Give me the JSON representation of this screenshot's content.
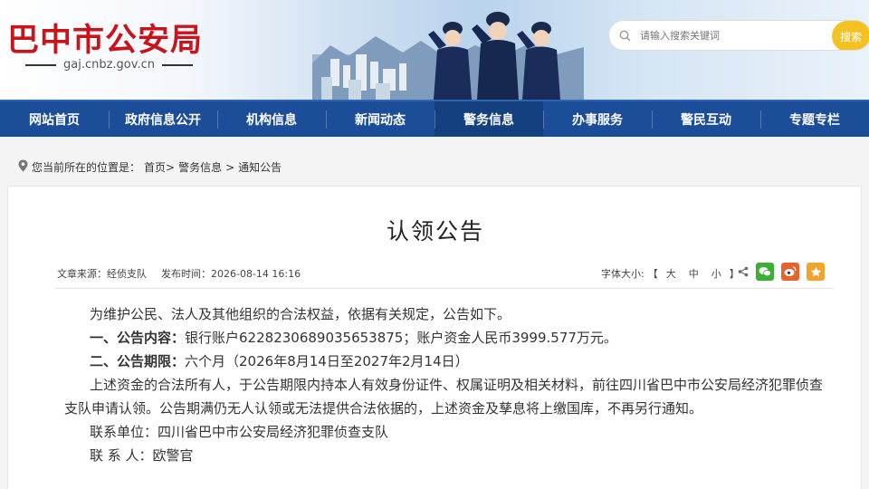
{
  "header": {
    "site_title": "巴中市公安局",
    "domain": "gaj.cnbz.gov.cn",
    "search_placeholder": "请输入搜索关键词",
    "search_button": "搜索"
  },
  "nav": {
    "items": [
      "网站首页",
      "政府信息公开",
      "机构信息",
      "新闻动态",
      "警务信息",
      "办事服务",
      "警民互动",
      "专题专栏"
    ],
    "active": "警务信息"
  },
  "breadcrumb": {
    "prefix": "您当前所在的位置是：",
    "home": "首页>",
    "section": "警务信息",
    "sep": ">",
    "current": "通知公告"
  },
  "article": {
    "title": "认领公告",
    "source_label": "文章来源：",
    "source": "经侦支队",
    "time_label": "发布时间：",
    "time": "2026-08-14 16:16",
    "fontsize_label": "字体大小:",
    "fontsize_open": "【",
    "fontsize_large": "大",
    "fontsize_medium": "中",
    "fontsize_small": "小",
    "fontsize_close": "】",
    "p1": "为维护公民、法人及其他组织的合法权益，依据有关规定，公告如下。",
    "p2_label": "一、公告内容：",
    "p2_text": "银行账户6228230689035653875；账户资金人民币3999.577万元。",
    "p3_label": "二、公告期限：",
    "p3_text": "六个月（2026年8月14日至2027年2月14日）",
    "p4_line1": "上述资金的合法所有人，于公告期限内持本人有效身份证件、权属证明及相关材料，前往四川省巴中市公安局经济犯罪侦查",
    "p4_line2": "支队申请认领。公告期满仍无人认领或无法提供合法依据的，上述资金及孳息将上缴国库，不再另行通知。",
    "p5": "联系单位：四川省巴中市公安局经济犯罪侦查支队",
    "p6": "联 系 人：欧警官"
  },
  "colors": {
    "brand_red": "#c8141b",
    "nav_blue": "#1c4d99",
    "search_yellow": "#f3c221",
    "wechat_green": "#3cb034",
    "weibo_orange": "#e8632b",
    "fav_orange": "#f0a42a"
  }
}
